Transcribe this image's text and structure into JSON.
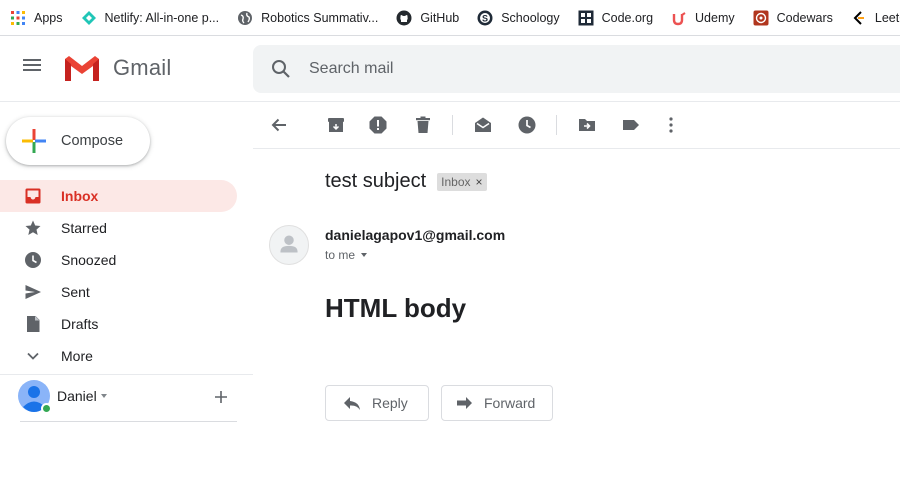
{
  "bookmarks": [
    {
      "label": "Apps",
      "icon": "apps-grid-icon"
    },
    {
      "label": "Netlify: All-in-one p...",
      "icon": "netlify-icon"
    },
    {
      "label": "Robotics Summativ...",
      "icon": "globe-icon"
    },
    {
      "label": "GitHub",
      "icon": "github-icon"
    },
    {
      "label": "Schoology",
      "icon": "schoology-icon"
    },
    {
      "label": "Code.org",
      "icon": "code-org-icon"
    },
    {
      "label": "Udemy",
      "icon": "udemy-icon"
    },
    {
      "label": "Codewars",
      "icon": "codewars-icon"
    },
    {
      "label": "LeetCode",
      "icon": "leetcode-icon"
    }
  ],
  "header": {
    "app_name": "Gmail",
    "search_placeholder": "Search mail"
  },
  "sidebar": {
    "compose_label": "Compose",
    "items": [
      {
        "label": "Inbox",
        "icon": "inbox-icon",
        "active": true
      },
      {
        "label": "Starred",
        "icon": "star-icon",
        "active": false
      },
      {
        "label": "Snoozed",
        "icon": "clock-icon",
        "active": false
      },
      {
        "label": "Sent",
        "icon": "send-icon",
        "active": false
      },
      {
        "label": "Drafts",
        "icon": "draft-icon",
        "active": false
      },
      {
        "label": "More",
        "icon": "chevron-down-icon",
        "active": false
      }
    ],
    "user_name": "Daniel"
  },
  "toolbar": {
    "buttons": [
      "back-icon",
      "archive-icon",
      "report-spam-icon",
      "delete-icon",
      "mark-unread-icon",
      "snooze-icon",
      "move-to-icon",
      "label-icon",
      "more-vert-icon"
    ]
  },
  "message": {
    "subject": "test subject",
    "label": "Inbox",
    "label_remove": "×",
    "sender": "danielagapov1@gmail.com",
    "recipient": "to me",
    "body": "HTML body"
  },
  "actions": {
    "reply_label": "Reply",
    "forward_label": "Forward"
  },
  "colors": {
    "active_bg": "#fce8e6",
    "active_text": "#d93025",
    "search_bg": "#f1f3f4",
    "presence": "#34a853"
  }
}
